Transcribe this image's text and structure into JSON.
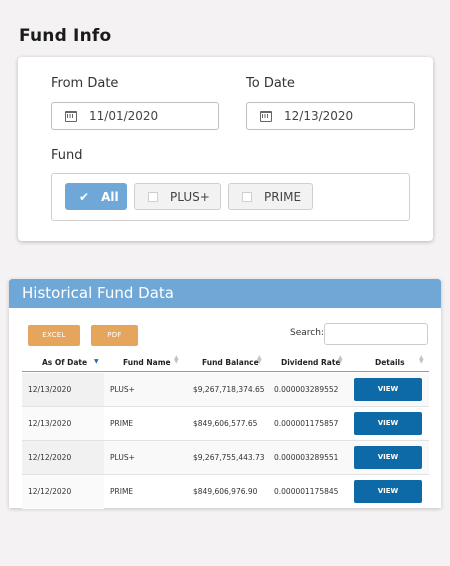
{
  "page_title": "Fund Info",
  "filters": {
    "from_label": "From Date",
    "from_value": "11/01/2020",
    "to_label": "To Date",
    "to_value": "12/13/2020",
    "fund_label": "Fund",
    "fund_options": [
      {
        "label": "All",
        "selected": true
      },
      {
        "label": "PLUS+",
        "selected": false
      },
      {
        "label": "PRIME",
        "selected": false
      }
    ]
  },
  "historical": {
    "title": "Historical Fund Data",
    "excel_label": "EXCEL",
    "pdf_label": "PDF",
    "search_label": "Search:",
    "search_value": "",
    "columns": [
      "As Of Date",
      "Fund Name",
      "Fund Balance",
      "Dividend Rate",
      "Details"
    ],
    "rows": [
      {
        "date": "12/13/2020",
        "fund": "PLUS+",
        "balance": "$9,267,718,374.65",
        "rate": "0.000003289552",
        "action": "VIEW"
      },
      {
        "date": "12/13/2020",
        "fund": "PRIME",
        "balance": "$849,606,577.65",
        "rate": "0.000001175857",
        "action": "VIEW"
      },
      {
        "date": "12/12/2020",
        "fund": "PLUS+",
        "balance": "$9,267,755,443.73",
        "rate": "0.000003289551",
        "action": "VIEW"
      },
      {
        "date": "12/12/2020",
        "fund": "PRIME",
        "balance": "$849,606,976.90",
        "rate": "0.000001175845",
        "action": "VIEW"
      }
    ]
  }
}
